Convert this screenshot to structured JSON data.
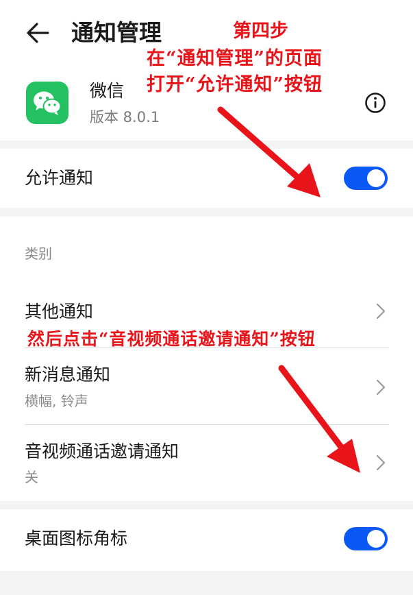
{
  "header": {
    "title": "通知管理",
    "app_name": "微信",
    "app_version": "版本 8.0.1"
  },
  "allow": {
    "label": "允许通知",
    "enabled": true
  },
  "categories": {
    "section_label": "类别",
    "items": [
      {
        "label": "其他通知",
        "sub": ""
      },
      {
        "label": "新消息通知",
        "sub": "横幅, 铃声"
      },
      {
        "label": "音视频通话邀请通知",
        "sub": "关"
      }
    ]
  },
  "badge": {
    "label": "桌面图标角标",
    "enabled": true
  },
  "annotations": {
    "step": "第四步",
    "line1": "在“通知管理”的页面",
    "line2": "打开“允许通知”按钮",
    "line3": "然后点击“音视频通话邀请通知”按钮"
  },
  "colors": {
    "accent": "#0a59f7",
    "wechat": "#23c160",
    "annotation": "#e8141a"
  },
  "icons": {
    "back": "back-arrow-icon",
    "info": "info-icon",
    "chevron": "chevron-right-icon",
    "app": "wechat-icon"
  }
}
